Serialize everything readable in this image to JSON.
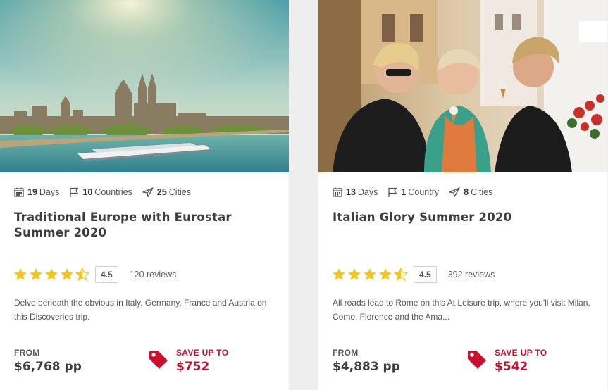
{
  "tours": [
    {
      "photo_subject": "river-city-cathedral",
      "days_value": "19",
      "days_label": "Days",
      "countries_value": "10",
      "countries_label": "Countries",
      "cities_value": "25",
      "cities_label": "Cities",
      "title": "Traditional Europe with Eurostar Summer 2020",
      "rating": "4.5",
      "reviews": "120 reviews",
      "description": "Delve beneath the obvious in Italy, Germany, France and Austria on this Discoveries trip.",
      "from_label": "FROM",
      "price": "$6,768 pp",
      "save_label": "SAVE UP TO",
      "save_amount": "$752"
    },
    {
      "photo_subject": "women-eating-gelato",
      "days_value": "13",
      "days_label": "Days",
      "countries_value": "1",
      "countries_label": "Country",
      "cities_value": "8",
      "cities_label": "Cities",
      "title": "Italian Glory Summer 2020",
      "rating": "4.5",
      "reviews": "392 reviews",
      "description": "All roads lead to Rome on this At Leisure trip, where you'll visit Milan, Como, Florence and the Ama...",
      "from_label": "FROM",
      "price": "$4,883 pp",
      "save_label": "SAVE UP TO",
      "save_amount": "$542"
    }
  ],
  "colors": {
    "accent_red": "#c8102e",
    "star_gold": "#f5c518",
    "text_dark": "#3d3d3d"
  },
  "icons": {
    "days": "calendar-icon",
    "countries": "flag-icon",
    "cities": "navigation-arrow-icon",
    "rating": "star-icon",
    "save": "price-tag-icon"
  }
}
